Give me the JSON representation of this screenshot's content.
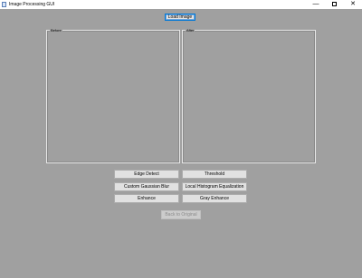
{
  "window": {
    "title": "Image Processing GUI",
    "minimize_glyph": "—",
    "close_glyph": "✕"
  },
  "toolbar": {
    "load_image": "Load Image"
  },
  "panels": {
    "before": "Before",
    "after": "After"
  },
  "operations": {
    "edge_detect": "Edge Detect",
    "threshold": "Threshold",
    "custom_gaussian_blur": "Custom Gaussian Blur",
    "local_histogram_equalization": "Local Histogram Equalization",
    "enhance": "Enhance",
    "gray_enhance": "Gray  Enhance",
    "back_to_original": "Back to Original"
  },
  "colors": {
    "background": "#a0a0a0",
    "button_face": "#e1e1e1",
    "focus_accent": "#0078d7"
  }
}
